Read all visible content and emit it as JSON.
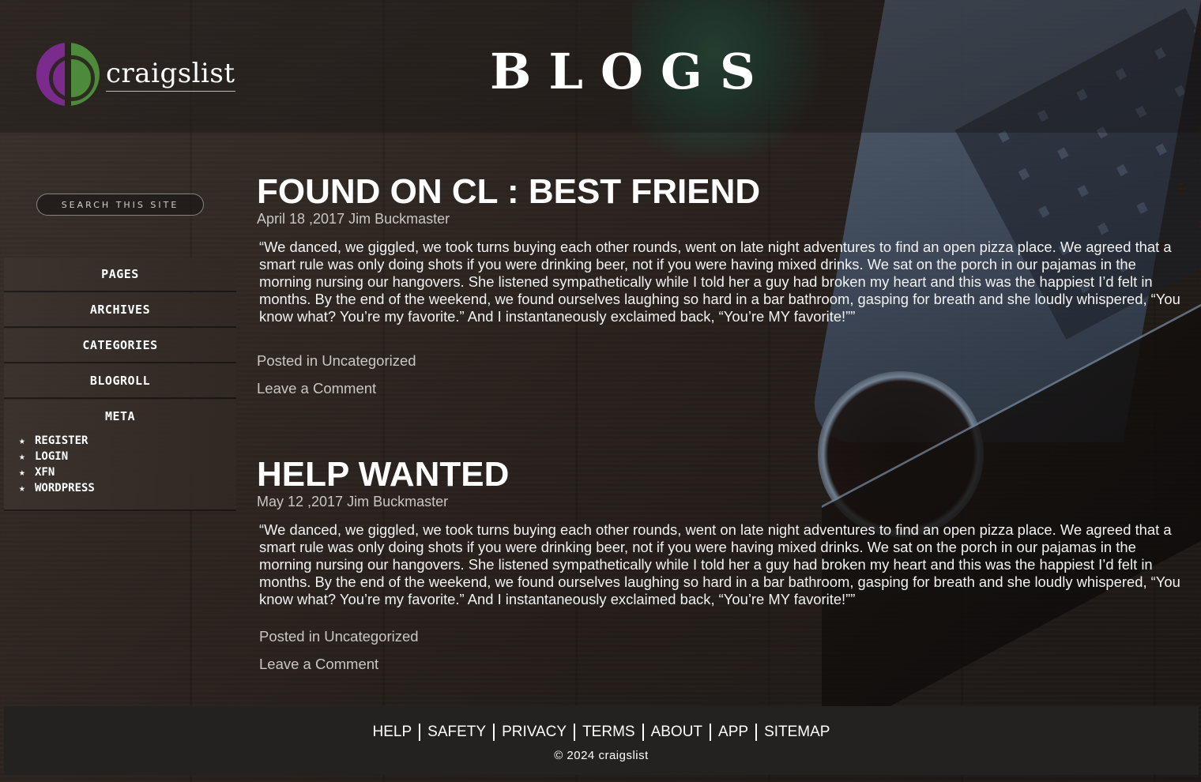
{
  "header": {
    "logo_text": "craigslist",
    "page_heading": "BLOGS"
  },
  "sidebar": {
    "search_placeholder": "SEARCH THIS SITE",
    "nav_items": [
      {
        "label": "PAGES"
      },
      {
        "label": "ARCHIVES"
      },
      {
        "label": "CATEGORIES"
      },
      {
        "label": "BLOGROLL"
      }
    ],
    "meta": {
      "title": "META",
      "star": "★",
      "items": [
        {
          "label": "REGISTER"
        },
        {
          "label": "LOGIN"
        },
        {
          "label": "XFN"
        },
        {
          "label": "WORDPRESS"
        }
      ]
    }
  },
  "posts": [
    {
      "title": "FOUND ON CL : BEST FRIEND",
      "meta": "April 18 ,2017 Jim Buckmaster",
      "body": "“We danced, we giggled, we took turns buying each other rounds, went on late night adventures to find an open pizza place. We agreed that a smart rule was only doing shots if you were drinking beer, not if you were having mixed drinks. We sat on the porch in our pajamas in the morning nursing our hangovers. She listened sympathetically while I told her a guy had broken my heart and this was the happiest I’d felt in months. By the end of the weekend, we found ourselves laughing so hard in a bar bathroom, gasping for breath and she loudly whispered, “You know what? You’re my favorite.” And I instantaneously exclaimed back, “You’re MY favorite!””",
      "posted_in_prefix": "Posted in ",
      "category": "Uncategorized",
      "comment_link": "Leave a Comment"
    },
    {
      "title": "HELP WANTED",
      "meta": "May 12 ,2017 Jim Buckmaster",
      "body": "“We danced, we giggled, we took turns buying each other rounds, went on late night adventures to find an open pizza place. We agreed that a smart rule was only doing shots if you were drinking beer, not if you were having mixed drinks. We sat on the porch in our pajamas in the morning nursing our hangovers. She listened sympathetically while I told her a guy had broken my heart and this was the happiest I’d felt in months. By the end of the weekend, we found ourselves laughing so hard in a bar bathroom, gasping for breath and she loudly whispered, “You know what? You’re my favorite.” And I instantaneously exclaimed back, “You’re MY favorite!””",
      "posted_in_prefix": "Posted in ",
      "category": "Uncategorized",
      "comment_link": "Leave a Comment"
    }
  ],
  "footer": {
    "links": [
      {
        "label": "HELP"
      },
      {
        "label": "SAFETY"
      },
      {
        "label": "PRIVACY"
      },
      {
        "label": "TERMS"
      },
      {
        "label": "ABOUT"
      },
      {
        "label": "APP"
      },
      {
        "label": "SITEMAP"
      }
    ],
    "copyright": "© 2024 craigslist"
  }
}
